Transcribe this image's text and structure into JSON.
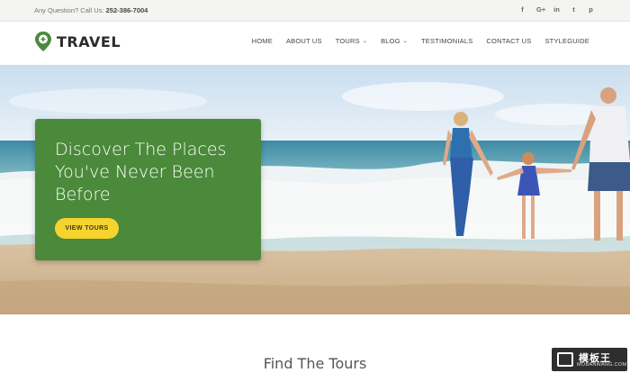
{
  "topbar": {
    "contact_prefix": "Any Question? Call Us:",
    "phone": "252-386-7004",
    "social_icons": [
      {
        "name": "facebook-icon",
        "glyph": "f"
      },
      {
        "name": "google-plus-icon",
        "glyph": "G+"
      },
      {
        "name": "linkedin-icon",
        "glyph": "in"
      },
      {
        "name": "twitter-icon",
        "glyph": "t"
      },
      {
        "name": "pinterest-icon",
        "glyph": "p"
      }
    ]
  },
  "header": {
    "logo_text": "TRAVEL",
    "nav": [
      {
        "label": "HOME",
        "dropdown": false
      },
      {
        "label": "ABOUT US",
        "dropdown": false
      },
      {
        "label": "TOURS",
        "dropdown": true
      },
      {
        "label": "BLOG",
        "dropdown": true
      },
      {
        "label": "TESTIMONIALS",
        "dropdown": false
      },
      {
        "label": "CONTACT US",
        "dropdown": false
      },
      {
        "label": "STYLEGUIDE",
        "dropdown": false
      }
    ]
  },
  "hero": {
    "headline": "Discover The Places You've Never Been Before",
    "cta_label": "VIEW TOURS"
  },
  "section": {
    "title": "Find The Tours"
  },
  "watermark": {
    "main": "模板王",
    "sub": "MOBANWANG.COM"
  },
  "colors": {
    "brand_green": "#4a8a3a",
    "cta_yellow": "#f6d32d",
    "topbar_bg": "#f4f4f2"
  }
}
